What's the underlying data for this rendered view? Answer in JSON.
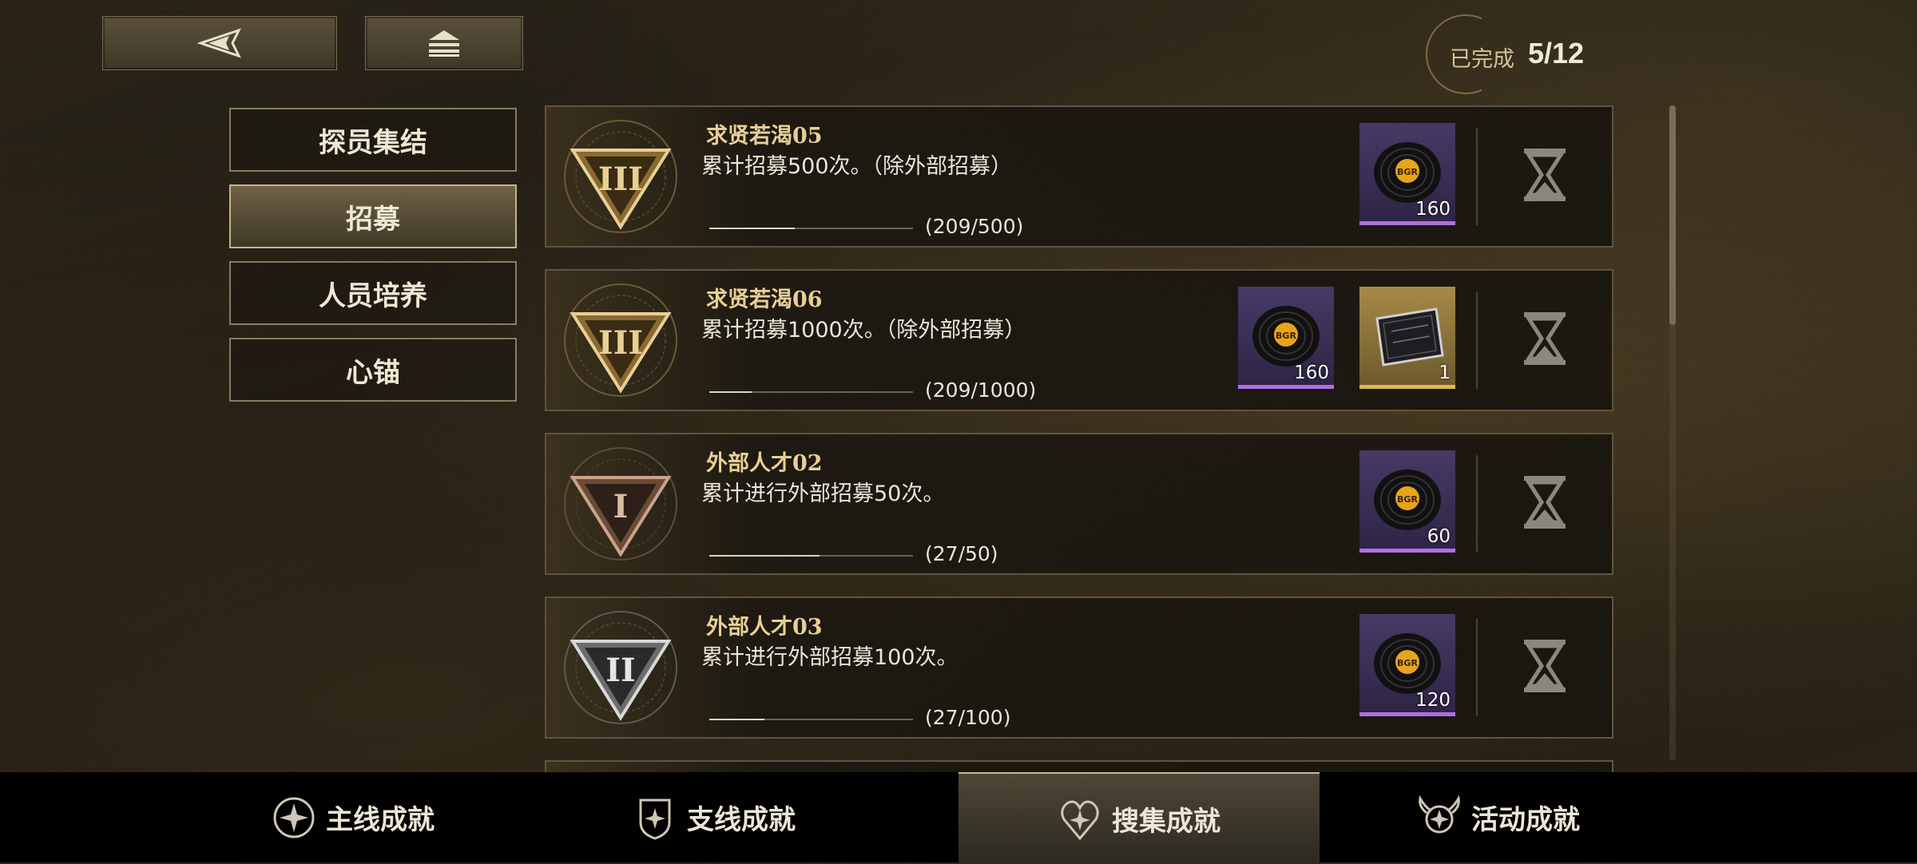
{
  "top_bar": {
    "back_icon": "back-triangle-icon",
    "home_icon": "home-stack-icon",
    "completed_label": "已完成",
    "completed_count": "5/12"
  },
  "side_nav": {
    "items": [
      {
        "label": "探员集结",
        "active": false
      },
      {
        "label": "招募",
        "active": true
      },
      {
        "label": "人员培养",
        "active": false
      },
      {
        "label": "心锚",
        "active": false
      }
    ]
  },
  "achievements": [
    {
      "title": "求贤若渴05",
      "desc": "累计招募500次。（除外部招募）",
      "progress_text": "(209/500)",
      "progress": 0.418,
      "badge": "III",
      "badge_color": "gold",
      "rewards": [
        {
          "type": "vinyl-record",
          "count": "160",
          "rarity": "purple"
        }
      ],
      "status_icon": "hourglass-icon"
    },
    {
      "title": "求贤若渴06",
      "desc": "累计招募1000次。（除外部招募）",
      "progress_text": "(209/1000)",
      "progress": 0.209,
      "badge": "III",
      "badge_color": "gold",
      "rewards": [
        {
          "type": "vinyl-record",
          "count": "160",
          "rarity": "purple"
        },
        {
          "type": "card-pack",
          "count": "1",
          "rarity": "gold"
        }
      ],
      "status_icon": "hourglass-icon"
    },
    {
      "title": "外部人才02",
      "desc": "累计进行外部招募50次。",
      "progress_text": "(27/50)",
      "progress": 0.54,
      "badge": "I",
      "badge_color": "bronze",
      "rewards": [
        {
          "type": "vinyl-record",
          "count": "60",
          "rarity": "purple"
        }
      ],
      "status_icon": "hourglass-icon"
    },
    {
      "title": "外部人才03",
      "desc": "累计进行外部招募100次。",
      "progress_text": "(27/100)",
      "progress": 0.27,
      "badge": "II",
      "badge_color": "silver",
      "rewards": [
        {
          "type": "vinyl-record",
          "count": "120",
          "rarity": "purple"
        }
      ],
      "status_icon": "hourglass-icon"
    }
  ],
  "bottom_tabs": [
    {
      "label": "主线成就",
      "icon": "compass-star-icon",
      "active": false
    },
    {
      "label": "支线成就",
      "icon": "shield-star-icon",
      "active": false
    },
    {
      "label": "搜集成就",
      "icon": "heart-star-icon",
      "active": true
    },
    {
      "label": "活动成就",
      "icon": "winged-star-icon",
      "active": false
    }
  ],
  "colors": {
    "accent_gold": "#e8cf96",
    "reward_purple": "#b06ee0",
    "reward_gold": "#e0b850"
  }
}
